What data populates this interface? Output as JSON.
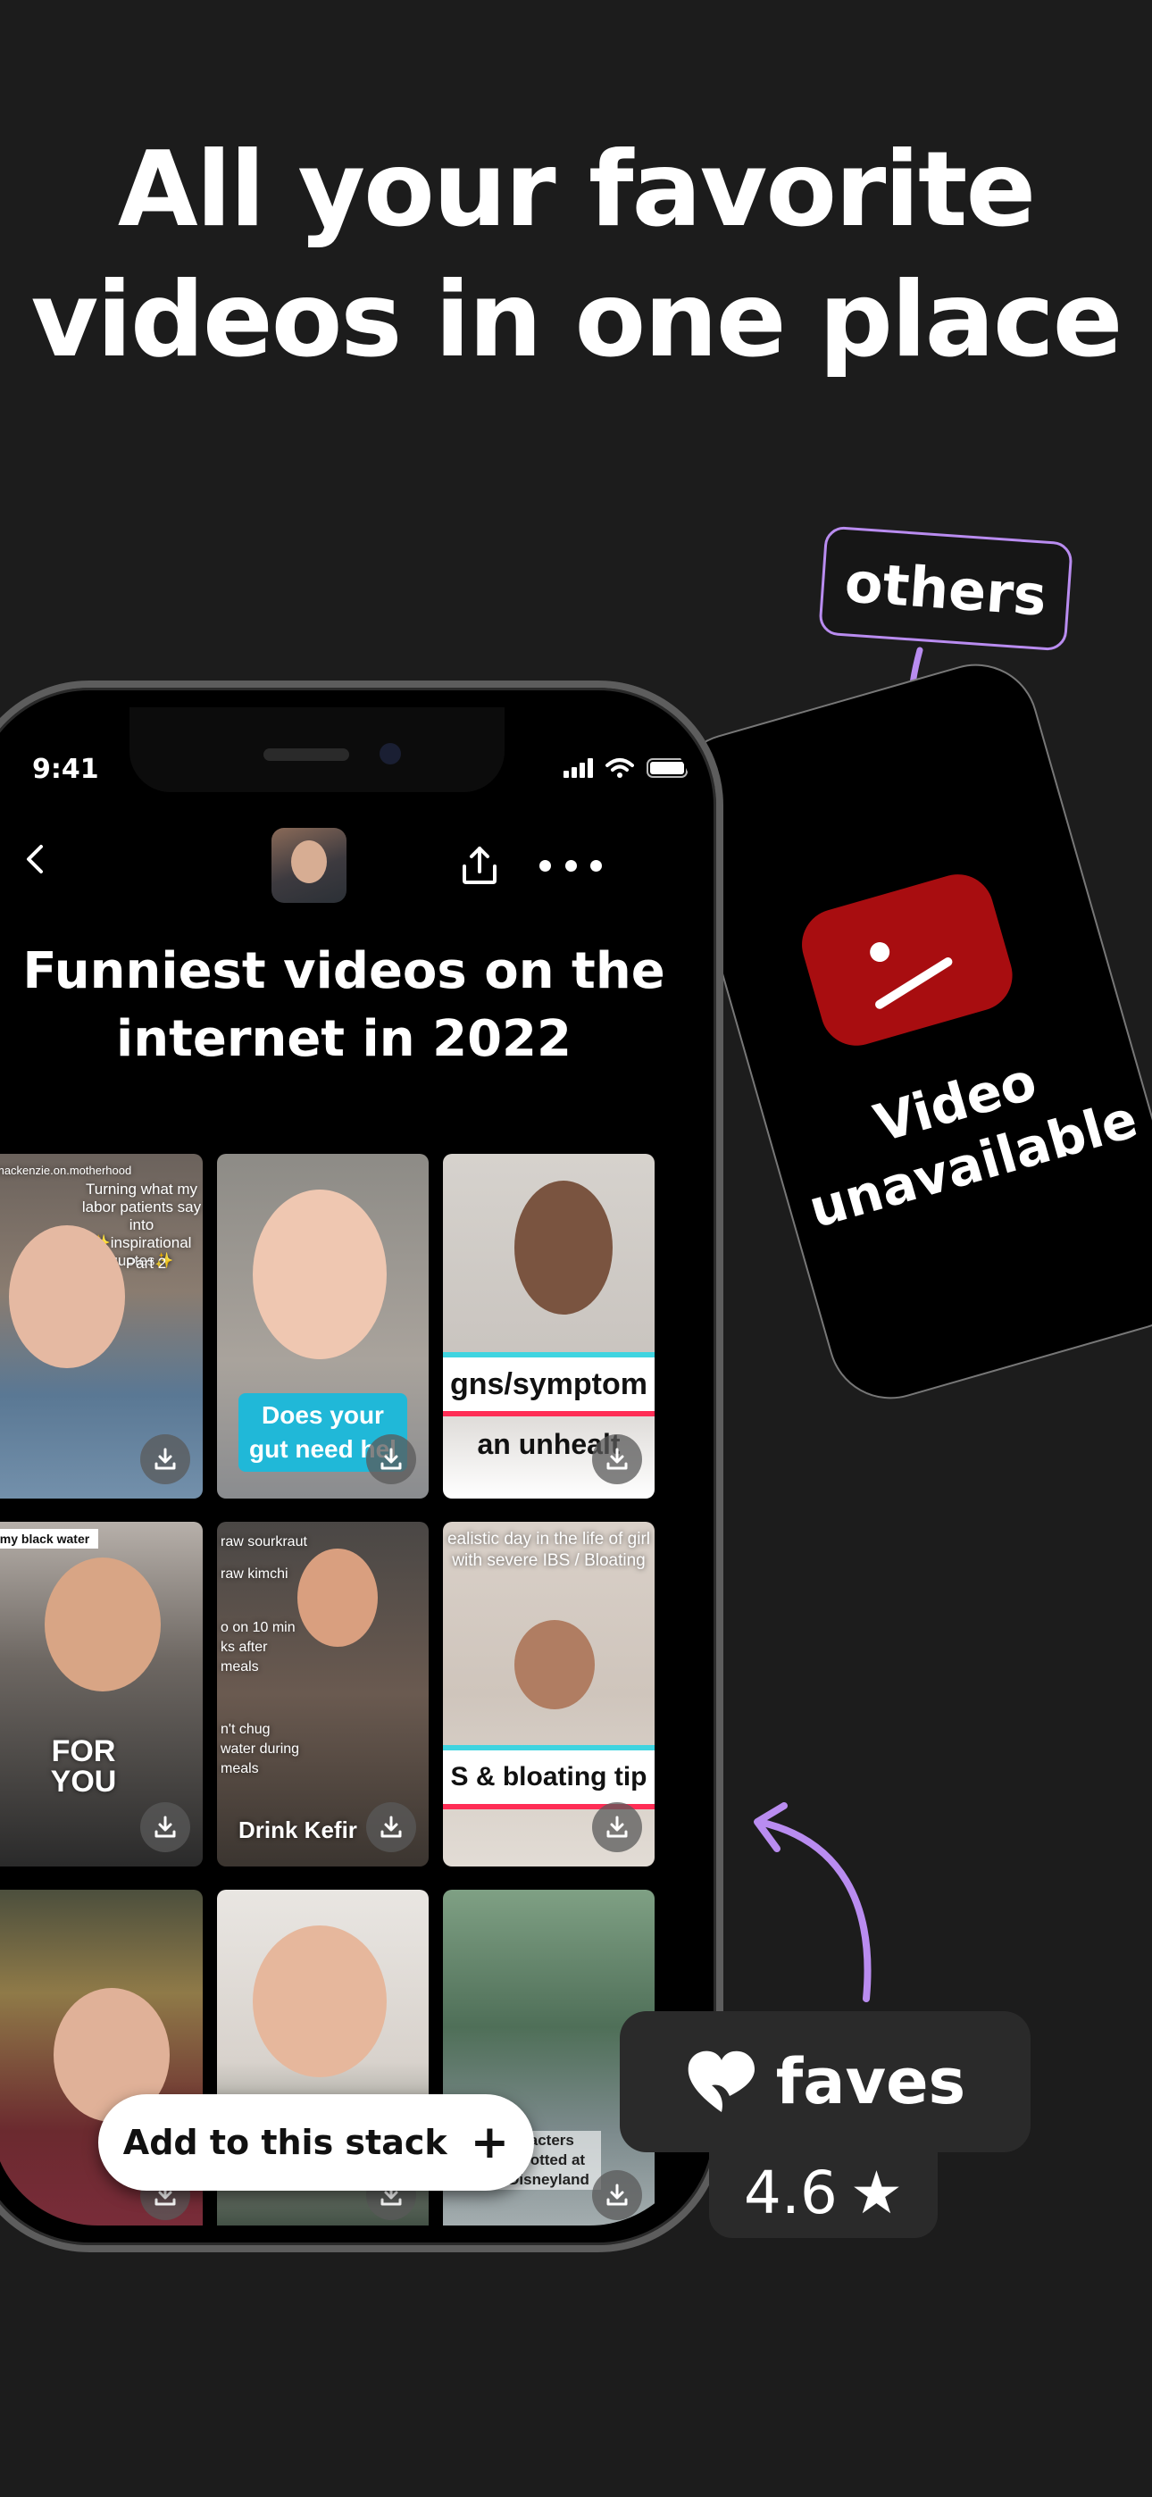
{
  "headline": {
    "line1": "All your favorite",
    "line2": "videos in one place"
  },
  "others_tag": "others",
  "unavailable": {
    "line1": "Video",
    "line2": "unavailable"
  },
  "status_bar": {
    "time": "9:41"
  },
  "stack": {
    "title_line1": "Funniest videos on the",
    "title_line2": "internet in 2022",
    "add_button": "Add to this stack",
    "add_icon": "+"
  },
  "tiles": [
    {
      "top": "Turning what my labor patients say into ✨inspirational quotes✨",
      "sub": "Part 2",
      "tag": "mackenzie.on.motherhood"
    },
    {
      "box": "Does your gut need hel"
    },
    {
      "band": "gns/symptom",
      "band2": "an unhealt"
    },
    {
      "top": "my black water",
      "mug": "FOR YOU"
    },
    {
      "top": "raw sourkraut",
      "top2": "raw kimchi",
      "mid": "o on 10 min ks after meals",
      "mid2": "n't chug water during meals",
      "bottom": "Drink Kefir"
    },
    {
      "top": "ealistic day in the life of girl with severe IBS / Bloating",
      "band": "S & bloating tip"
    },
    {},
    {},
    {
      "bottom": "racters spotted at Disneyland"
    }
  ],
  "faves": {
    "brand": "faves",
    "rating": "4.6",
    "star": "★"
  },
  "colors": {
    "background": "#1c1c1c",
    "accent_purple": "#b98cf0",
    "youtube_red": "#a80d10"
  }
}
